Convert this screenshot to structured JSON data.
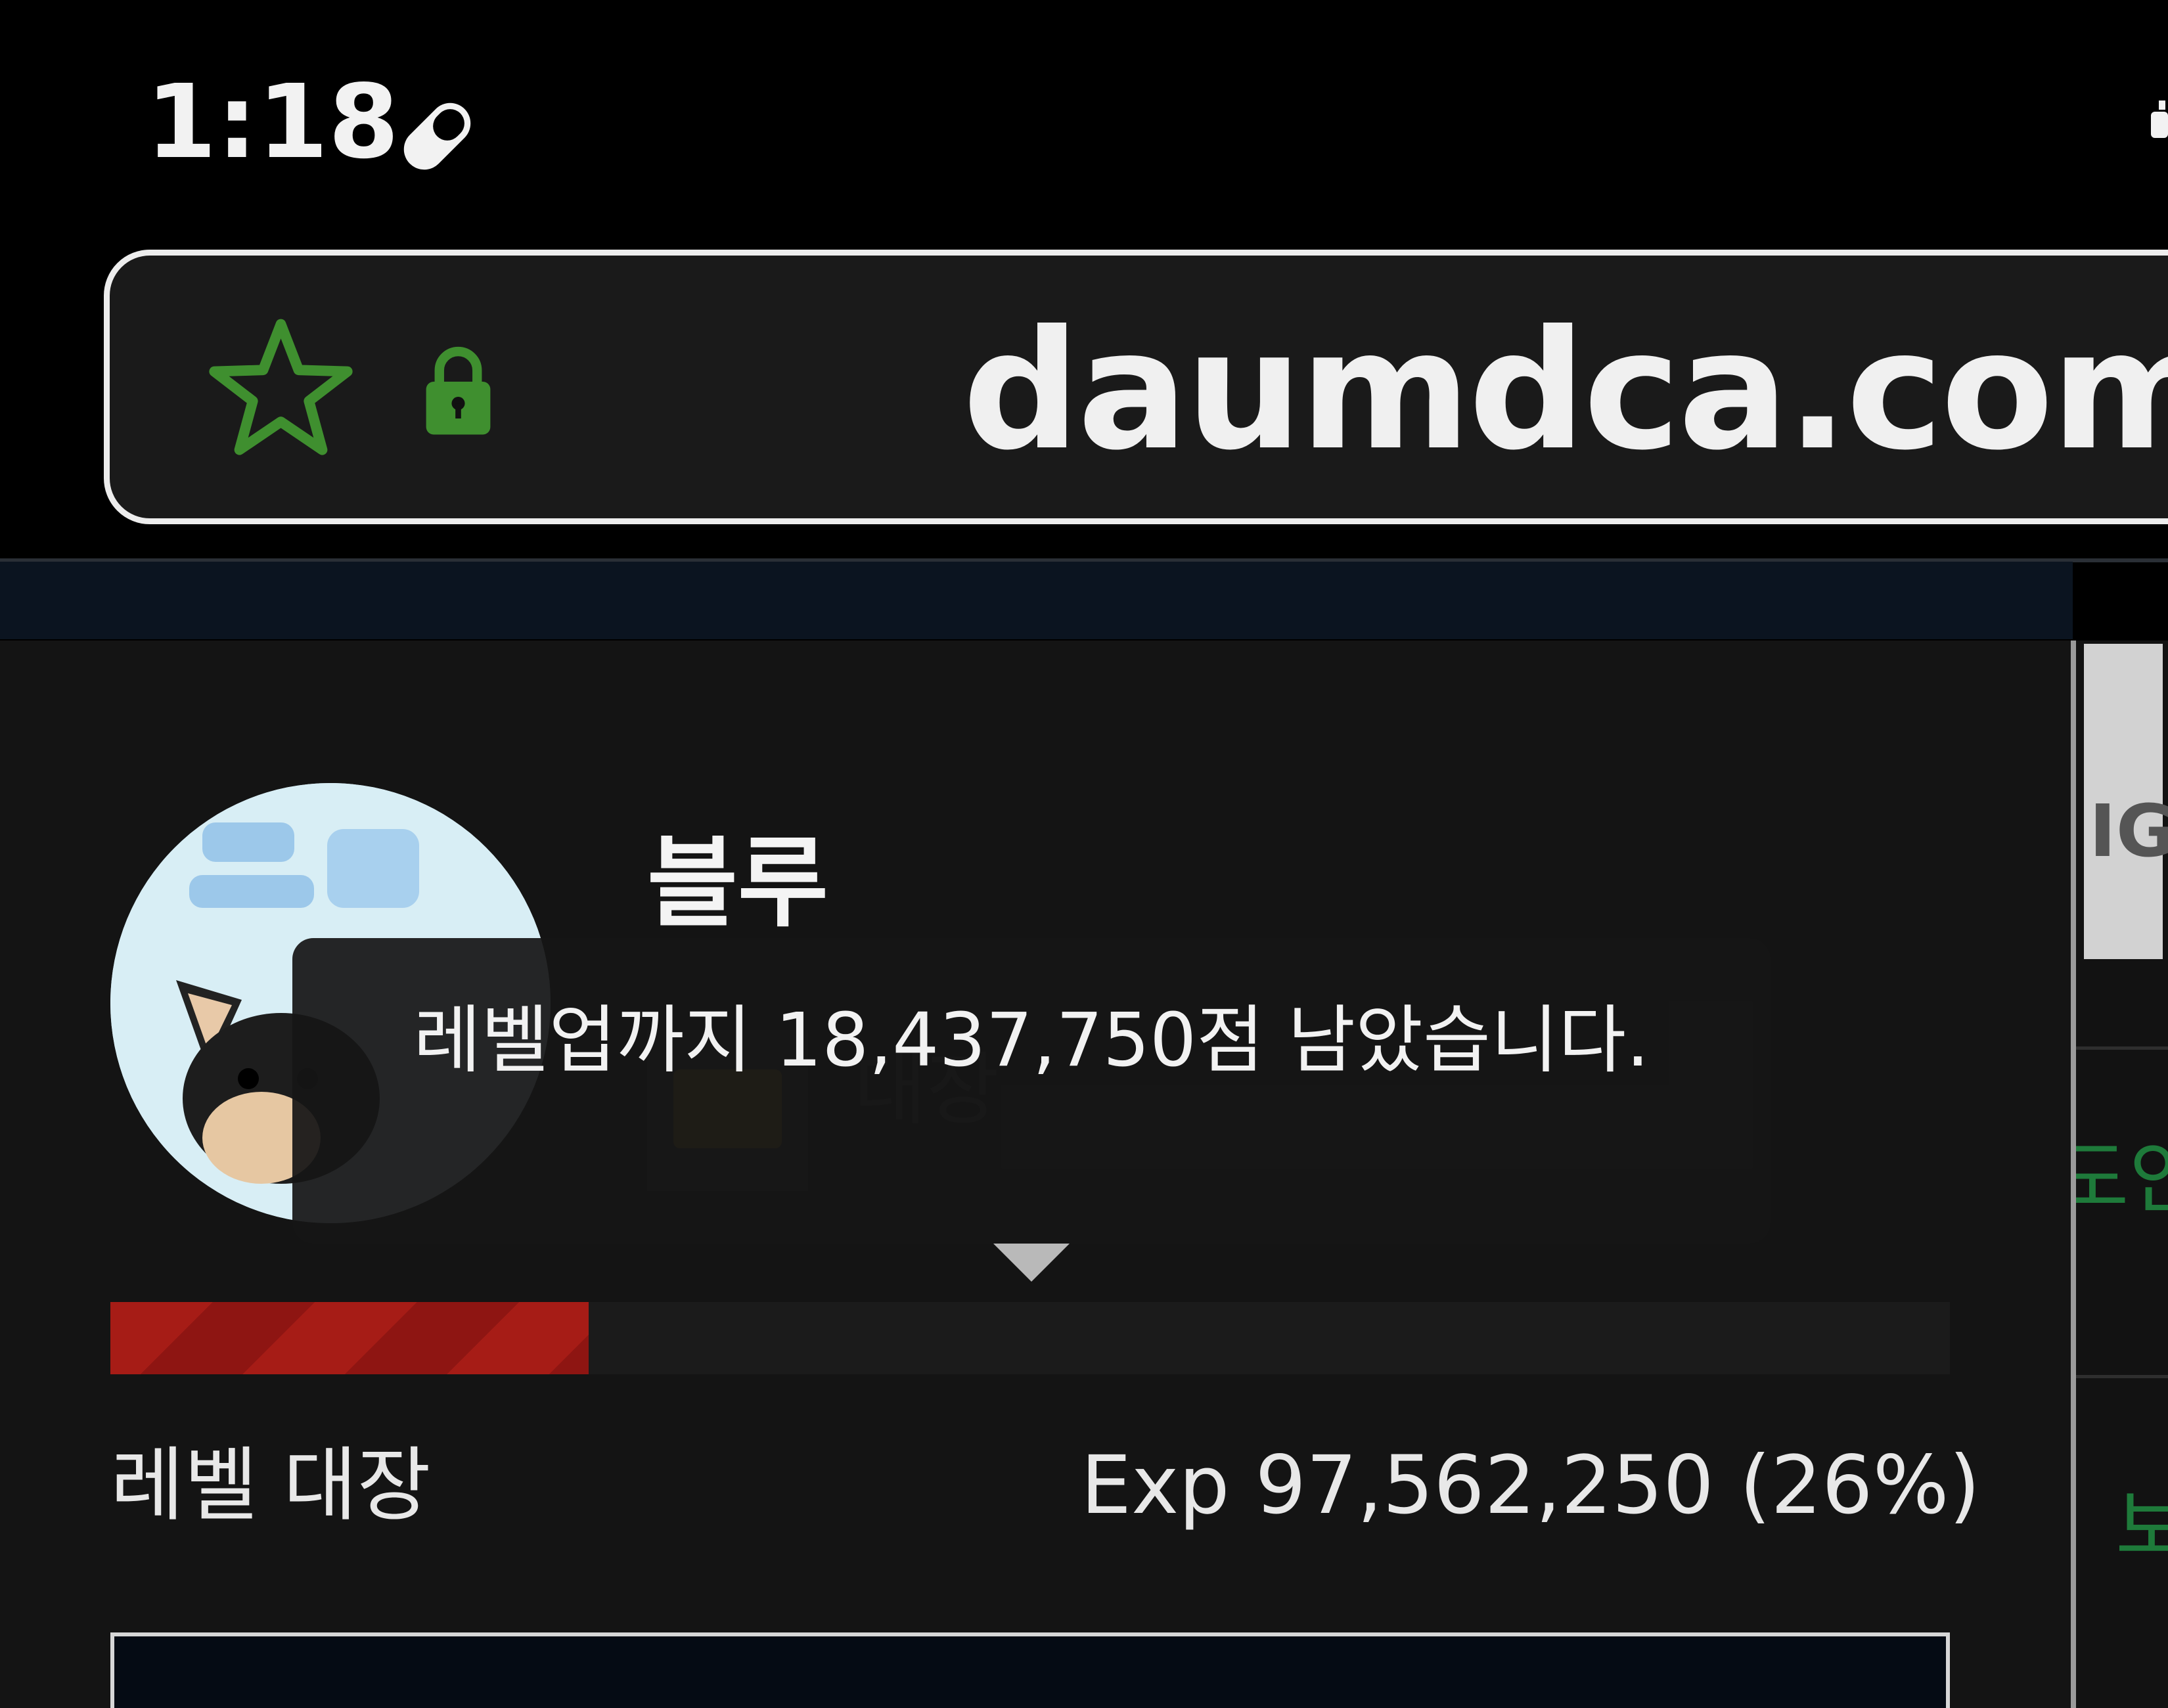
{
  "status_bar": {
    "time": "1:18",
    "notification_icon": "pill-icon"
  },
  "browser": {
    "url": "daumdca.com",
    "bookmark_icon": "star-outline-icon",
    "secure_icon": "lock-icon",
    "accent_color": "#3f8f2f"
  },
  "profile": {
    "username": "블루",
    "level_name_badge": "대장",
    "tooltip": "레벨업까지 18,437,750점 남았습니다.",
    "exp_progress": 0.26,
    "exp_bar_color": "#a61c16",
    "level_label": "레벨 대장",
    "exp_label": "Exp 97,562,250 (26%)"
  },
  "side_panel": {
    "thumb_text": "IG",
    "item_text_1": "도인",
    "item_text_2": "보"
  }
}
